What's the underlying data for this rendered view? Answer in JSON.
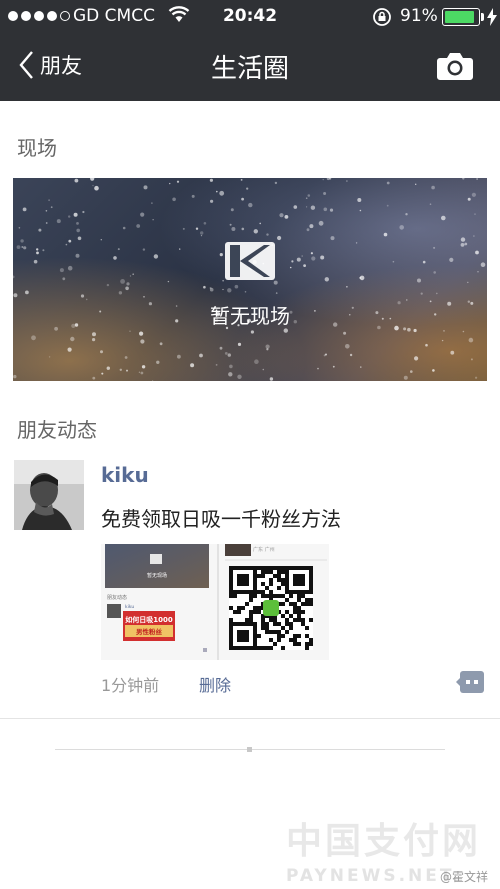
{
  "status_bar": {
    "carrier": "GD CMCC",
    "time": "20:42",
    "battery_percent": "91%",
    "battery_level": 0.91,
    "signal_bars": 4,
    "signal_total": 5
  },
  "nav": {
    "back_label": "朋友",
    "title": "生活圈"
  },
  "live_section": {
    "header": "现场",
    "empty_text": "暂无现场"
  },
  "feed_section": {
    "header": "朋友动态"
  },
  "post": {
    "username": "kiku",
    "text": "免费领取日吸一千粉丝方法",
    "thumb_left": {
      "live_label": "暂无现场",
      "section_label": "朋友动态",
      "user": "kiku",
      "banner_line1": "如何日吸1000",
      "banner_line2": "男性粉丝"
    },
    "thumb_right": {
      "caption": "广东 广州"
    },
    "time": "1分钟前",
    "delete_label": "删除"
  },
  "watermark": {
    "cn": "中国支付网",
    "en": "PAYNEWS.NET",
    "handle": "@霍文祥"
  },
  "colors": {
    "nav_bg": "#2f3135",
    "link": "#576b95",
    "battery": "#4cd964",
    "banner_red": "#d22f2f"
  }
}
